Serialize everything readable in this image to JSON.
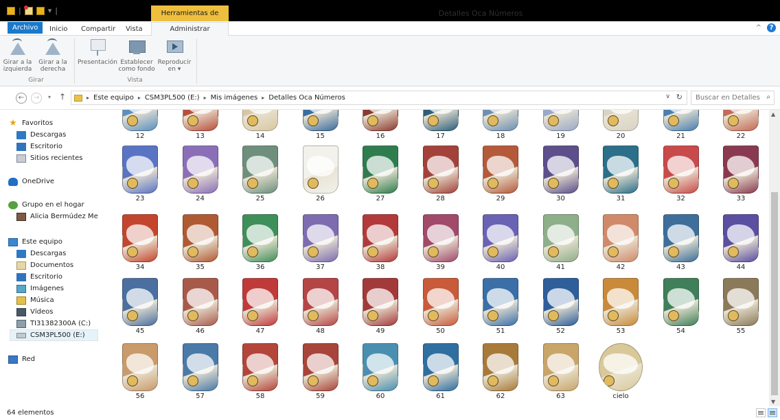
{
  "window": {
    "title": "Detalles Oca Números",
    "context_tab": "Herramientas de imagen"
  },
  "ribbon_tabs": [
    "Archivo",
    "Inicio",
    "Compartir",
    "Vista",
    "Administrar"
  ],
  "ribbon": {
    "buttons": [
      {
        "line1": "Girar a la",
        "line2": "izquierda",
        "icon": "rotate-left-icon"
      },
      {
        "line1": "Girar a la",
        "line2": "derecha",
        "icon": "rotate-right-icon"
      },
      {
        "line1": "Presentación",
        "line2": "",
        "icon": "slideshow-icon"
      },
      {
        "line1": "Establecer",
        "line2": "como fondo",
        "icon": "set-background-icon"
      },
      {
        "line1": "Reproducir",
        "line2": "en",
        "icon": "play-to-icon"
      }
    ],
    "groups": [
      "Girar",
      "Vista"
    ]
  },
  "address": {
    "crumbs": [
      "Este equipo",
      "CSM3PL500 (E:)",
      "Mis imágenes",
      "Detalles Oca Números"
    ],
    "search_placeholder": "Buscar en Detalles ..."
  },
  "nav": {
    "items": [
      {
        "label": "Favoritos",
        "icon": "star-icon",
        "indent": 0
      },
      {
        "label": "Descargas",
        "icon": "downloads-folder-icon",
        "indent": 1
      },
      {
        "label": "Escritorio",
        "icon": "desktop-folder-icon",
        "indent": 1
      },
      {
        "label": "Sitios recientes",
        "icon": "recent-places-icon",
        "indent": 1
      },
      {
        "label": "OneDrive",
        "icon": "onedrive-icon",
        "indent": 0
      },
      {
        "label": "Grupo en el hogar",
        "icon": "homegroup-icon",
        "indent": 0
      },
      {
        "label": "Alicia Bermúdez Meri",
        "icon": "user-icon",
        "indent": 1
      },
      {
        "label": "Este equipo",
        "icon": "this-pc-icon",
        "indent": 0
      },
      {
        "label": "Descargas",
        "icon": "downloads-folder-icon",
        "indent": 1
      },
      {
        "label": "Documentos",
        "icon": "documents-folder-icon",
        "indent": 1
      },
      {
        "label": "Escritorio",
        "icon": "desktop-folder-icon",
        "indent": 1
      },
      {
        "label": "Imágenes",
        "icon": "pictures-folder-icon",
        "indent": 1
      },
      {
        "label": "Música",
        "icon": "music-folder-icon",
        "indent": 1
      },
      {
        "label": "Vídeos",
        "icon": "videos-folder-icon",
        "indent": 1
      },
      {
        "label": "TI31382300A (C:)",
        "icon": "drive-c-icon",
        "indent": 1
      },
      {
        "label": "CSM3PL500 (E:)",
        "icon": "drive-e-icon",
        "indent": 1,
        "selected": true
      },
      {
        "label": "Red",
        "icon": "network-icon",
        "indent": 0
      }
    ]
  },
  "files": {
    "labels": [
      "12",
      "13",
      "14",
      "15",
      "16",
      "17",
      "18",
      "19",
      "20",
      "21",
      "22",
      "23",
      "24",
      "25",
      "26",
      "27",
      "28",
      "29",
      "30",
      "31",
      "32",
      "33",
      "34",
      "35",
      "36",
      "37",
      "38",
      "39",
      "40",
      "41",
      "42",
      "43",
      "44",
      "45",
      "46",
      "47",
      "48",
      "49",
      "50",
      "51",
      "52",
      "53",
      "54",
      "55",
      "56",
      "57",
      "58",
      "59",
      "60",
      "61",
      "62",
      "63",
      "cielo"
    ],
    "colors": [
      "#5b8fbf",
      "#b94f3c",
      "#d9c7a3",
      "#3b6c9e",
      "#8c3a2e",
      "#2e5f7a",
      "#6d8fb3",
      "#9aa9c7",
      "#d8d3c5",
      "#4a7fb0",
      "#c46a55",
      "#5a74c4",
      "#8a6fb8",
      "#6e8f7c",
      "#f2f1ec",
      "#2f7d4f",
      "#a3423a",
      "#b45a3a",
      "#5c4f8c",
      "#2b6f8a",
      "#c94a4a",
      "#8a3a50",
      "#c4452e",
      "#b05a33",
      "#3f8f5a",
      "#7d6db0",
      "#b33a3a",
      "#a14a6a",
      "#6a62b3",
      "#8fae8a",
      "#d08a6a",
      "#3d6f9a",
      "#5a4fa0",
      "#4a6fa0",
      "#a85a4a",
      "#c03a3a",
      "#b54545",
      "#a33a3a",
      "#c95a3a",
      "#3a6fa8",
      "#2f5f9a",
      "#c98a3a",
      "#3f7f5a",
      "#8a7a5a",
      "#c99a6a",
      "#4a7aa8",
      "#b3453a",
      "#a8453a",
      "#4a8fb0",
      "#2f6fa0",
      "#a87a3a",
      "#c9a56a",
      "#d9c99a"
    ],
    "count_text": "64 elementos"
  },
  "colors": {
    "accent": "#1979ca",
    "context_tab": "#eebe3e",
    "selection": "#e5f3fb"
  }
}
